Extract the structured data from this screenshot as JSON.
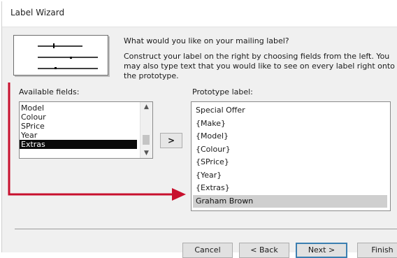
{
  "window": {
    "title": "Label Wizard"
  },
  "intro": {
    "question": "What would you like on your mailing label?",
    "instructions": "Construct your label on the right by choosing fields from the left. You may also type text that you would like to see on every label right onto the prototype."
  },
  "available": {
    "label": "Available fields:",
    "items": [
      "Model",
      "Colour",
      "SPrice",
      "Year",
      "Extras"
    ],
    "selected": "Extras"
  },
  "add_button": ">",
  "prototype": {
    "label": "Prototype label:",
    "lines": [
      "Special Offer",
      "{Make}",
      "{Model}",
      "{Colour}",
      "{SPrice}",
      "{Year}",
      "{Extras}",
      "Graham Brown"
    ],
    "highlighted": "Graham Brown"
  },
  "buttons": {
    "cancel": "Cancel",
    "back": "< Back",
    "next": "Next >",
    "finish": "Finish"
  },
  "colors": {
    "annotation_arrow": "#c8102e",
    "selection_dark": "#0a0a0a",
    "selection_grey": "#cfcfcf"
  }
}
